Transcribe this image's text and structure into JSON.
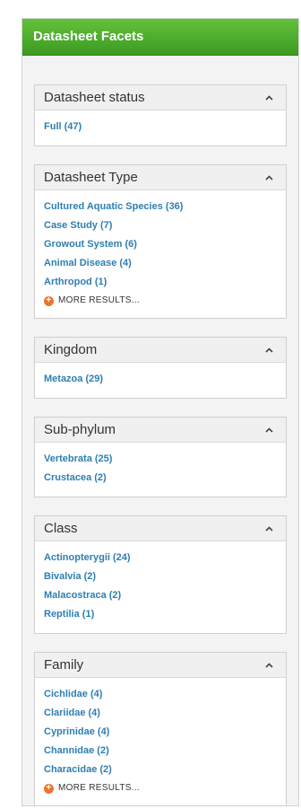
{
  "panel": {
    "title": "Datasheet Facets"
  },
  "facets": [
    {
      "key": "datasheet-status",
      "title": "Datasheet status",
      "items": [
        "Full (47)"
      ]
    },
    {
      "key": "datasheet-type",
      "title": "Datasheet Type",
      "items": [
        "Cultured Aquatic Species (36)",
        "Case Study (7)",
        "Growout System (6)",
        "Animal Disease (4)",
        "Arthropod (1)"
      ],
      "more": "MORE RESULTS..."
    },
    {
      "key": "kingdom",
      "title": "Kingdom",
      "items": [
        "Metazoa (29)"
      ]
    },
    {
      "key": "sub-phylum",
      "title": "Sub-phylum",
      "items": [
        "Vertebrata (25)",
        "Crustacea (2)"
      ]
    },
    {
      "key": "class",
      "title": "Class",
      "items": [
        "Actinopterygii (24)",
        "Bivalvia (2)",
        "Malacostraca (2)",
        "Reptilia (1)"
      ]
    },
    {
      "key": "family",
      "title": "Family",
      "items": [
        "Cichlidae (4)",
        "Clariidae (4)",
        "Cyprinidae (4)",
        "Channidae (2)",
        "Characidae (2)"
      ],
      "more": "MORE RESULTS..."
    }
  ],
  "icons": {
    "collapse": "chevron-up-icon",
    "more": "plus-circle-icon"
  },
  "colors": {
    "header_green": "#4caf2c",
    "link_blue": "#2d7fb2",
    "more_orange": "#e8772d"
  }
}
